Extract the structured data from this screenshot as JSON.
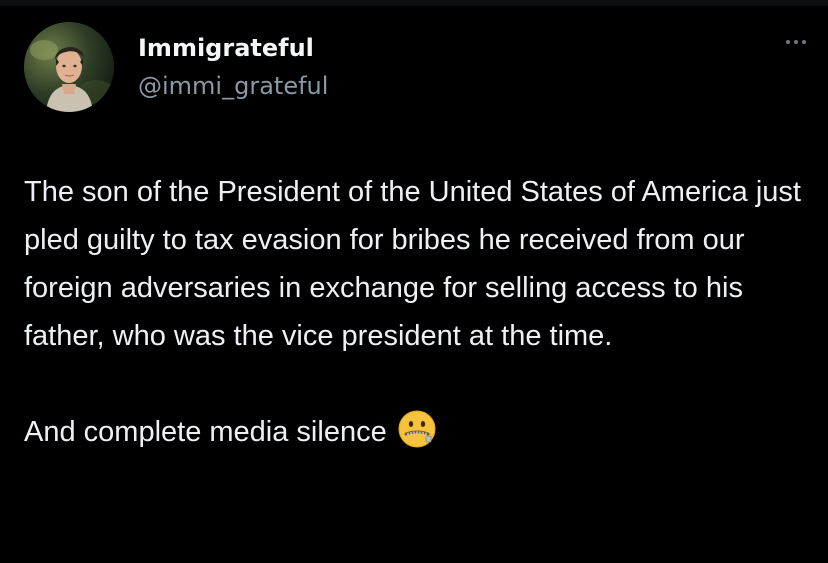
{
  "tweet": {
    "author": {
      "display_name": "Immigrateful",
      "handle": "@immi_grateful",
      "avatar_icon": "profile-photo"
    },
    "more_icon": "ellipsis-icon",
    "body": {
      "paragraph_1": "The son of the President of the United States of America just pled guilty to tax evasion for bribes he received from our foreign adversaries in exchange for selling access to his father, who was the vice president at the time.",
      "paragraph_2": "And complete media silence",
      "emoji": "zipper-mouth-face"
    }
  },
  "colors": {
    "background": "#000000",
    "text_primary": "#eef1f4",
    "text_secondary": "#8b98a5",
    "emoji_yellow": "#f7c33c"
  }
}
